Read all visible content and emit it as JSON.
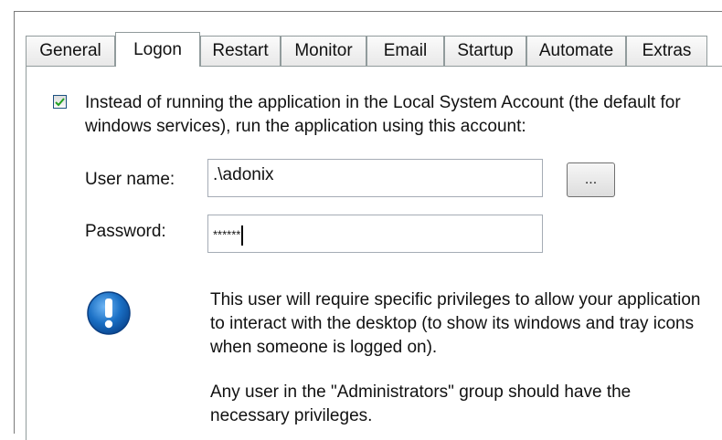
{
  "tabs": [
    {
      "label": "General"
    },
    {
      "label": "Logon"
    },
    {
      "label": "Restart"
    },
    {
      "label": "Monitor"
    },
    {
      "label": "Email"
    },
    {
      "label": "Startup"
    },
    {
      "label": "Automate"
    },
    {
      "label": "Extras"
    }
  ],
  "active_tab": "Logon",
  "logon": {
    "use_account_checked": true,
    "use_account_text": "Instead of running the application in the Local System Account (the default for windows services), run the application using this account:",
    "username_label": "User name:",
    "username_value": ".\\adonix",
    "browse_label": "...",
    "password_label": "Password:",
    "password_value": "******",
    "note_privileges": "This user will require specific privileges to allow your application to interact with the desktop (to show its windows and tray icons when someone is logged on).",
    "note_admin": "Any user in the \"Administrators\" group should have the necessary privileges."
  },
  "colors": {
    "icon_blue": "#1a6fc4",
    "tab_border": "#919b9c"
  },
  "icons": {
    "info": "exclamation-info-icon"
  }
}
